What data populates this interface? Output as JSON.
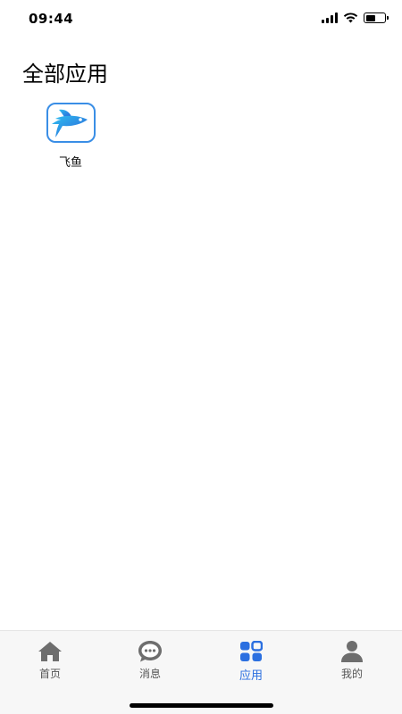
{
  "status_bar": {
    "time": "09:44",
    "icons": [
      "cellular-signal-icon",
      "wifi-icon",
      "battery-icon"
    ],
    "battery_level": 0.6
  },
  "page": {
    "title": "全部应用"
  },
  "apps": [
    {
      "label": "飞鱼",
      "icon": "flying-fish-icon"
    }
  ],
  "bottom_nav": {
    "items": [
      {
        "label": "首页",
        "icon": "home-icon",
        "active": false
      },
      {
        "label": "消息",
        "icon": "message-bubble-icon",
        "active": false
      },
      {
        "label": "应用",
        "icon": "apps-grid-icon",
        "active": true
      },
      {
        "label": "我的",
        "icon": "person-icon",
        "active": false
      }
    ]
  },
  "colors": {
    "accent": "#2b6fe0",
    "inactive": "#555555",
    "icon_gray": "#6e6e6e",
    "app_icon_border": "#3a8ee6"
  }
}
